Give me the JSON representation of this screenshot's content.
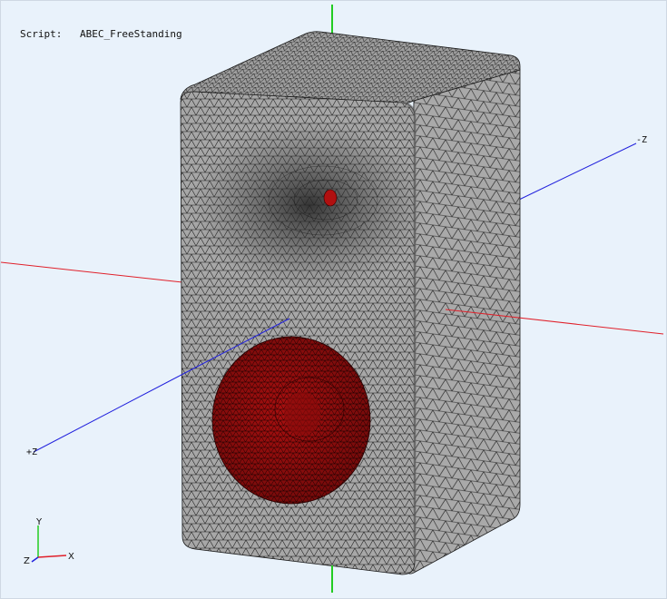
{
  "viewport": {
    "script_label": "Script:",
    "script_name": "ABEC_FreeStanding"
  },
  "axes": {
    "neg_z_label": "-Z",
    "pos_z_label": "+Z"
  },
  "triad": {
    "y_label": "Y",
    "x_label": "X",
    "z_label": "Z"
  },
  "colors": {
    "background": "#e9f2fb",
    "mesh_face": "#a3a3a3",
    "mesh_line": "#1a1a1a",
    "driver": "#b01010",
    "axis_x": "#e0202a",
    "axis_y": "#22cc22",
    "axis_z": "#2222dd"
  }
}
